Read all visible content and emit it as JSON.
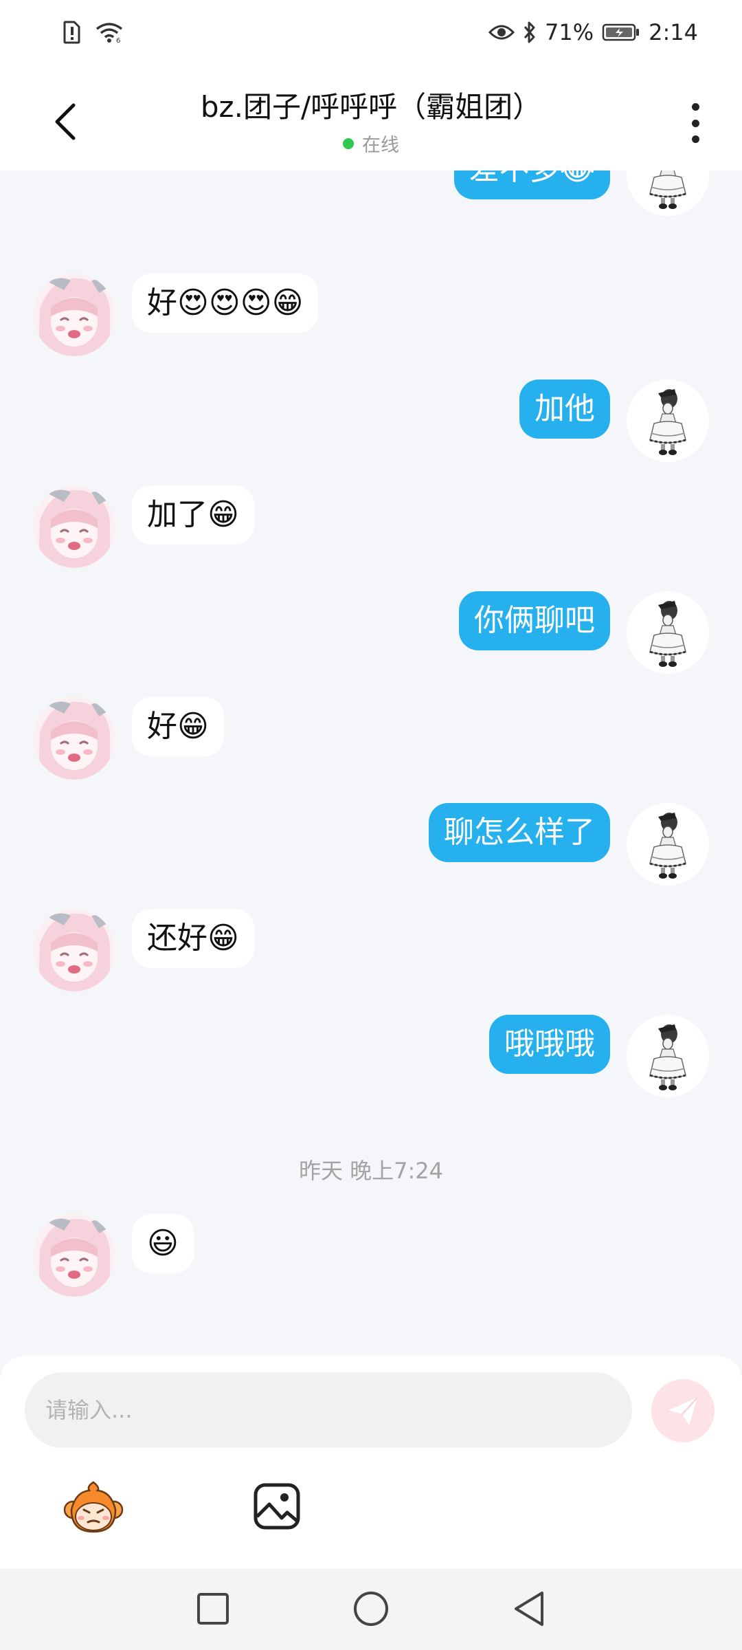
{
  "status_bar": {
    "battery_percent": "71%",
    "time": "2:14"
  },
  "header": {
    "title": "bz.团子/呼呼呼（霸姐团）",
    "presence": "在线"
  },
  "messages": [
    {
      "side": "me",
      "text": "差不多😂"
    },
    {
      "side": "other",
      "text": "好😍😍😍😁"
    },
    {
      "side": "me",
      "text": "加他"
    },
    {
      "side": "other",
      "text": "加了😁"
    },
    {
      "side": "me",
      "text": "你俩聊吧"
    },
    {
      "side": "other",
      "text": "好😁"
    },
    {
      "side": "me",
      "text": "聊怎么样了"
    },
    {
      "side": "other",
      "text": "还好😁"
    },
    {
      "side": "me",
      "text": "哦哦哦"
    },
    {
      "side": "other",
      "text": "😃"
    }
  ],
  "timestamp": "昨天 晚上7:24",
  "composer": {
    "placeholder": "请输入..."
  },
  "colors": {
    "my_bubble": "#26b0ee",
    "other_bubble": "#ffffff",
    "online_dot": "#2fc84e",
    "send_button": "#fde3e6"
  }
}
